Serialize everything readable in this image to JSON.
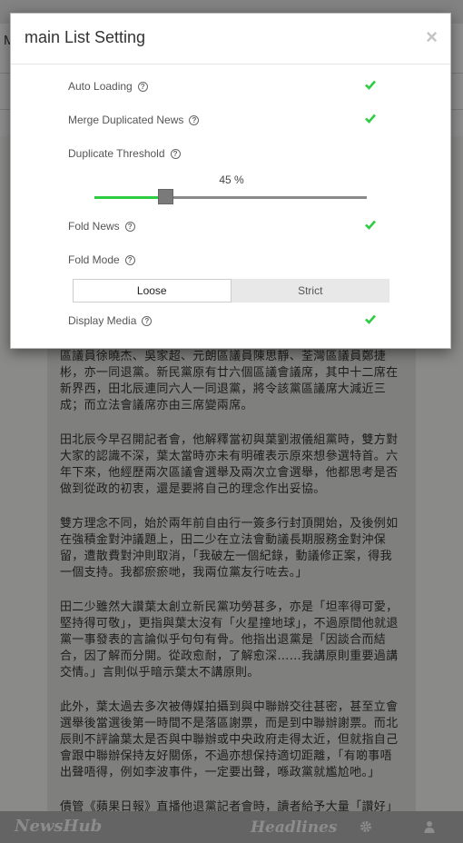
{
  "modal": {
    "title": "main List Setting",
    "close_label": "×"
  },
  "settings": {
    "auto_loading": {
      "label": "Auto Loading",
      "enabled": true
    },
    "merge_duplicated_news": {
      "label": "Merge Duplicated News",
      "enabled": true
    },
    "duplicate_threshold": {
      "label": "Duplicate Threshold",
      "value_text": "45 %",
      "value": 0.45
    },
    "fold_news": {
      "label": "Fold News",
      "enabled": true
    },
    "fold_mode": {
      "label": "Fold Mode",
      "options": [
        "Loose",
        "Strict"
      ],
      "selected": "Loose"
    },
    "display_media": {
      "label": "Display Media",
      "enabled": true
    }
  },
  "help_glyph": "?",
  "background_app": {
    "header_letter": "M",
    "article_paragraphs": [
      "區議員徐曉杰、吳家超、元朗區議員陳思靜、荃灣區議員鄭捷彬，亦一同退黨。新民黨原有廿六個區議會議席，其中十二席在新界西，田北辰連同六人一同退黨，將令該黨區議席大減近三成；而立法會議席亦由三席變兩席。",
      "田北辰今早召開記者會，他解釋當初與葉劉淑儀組黨時，雙方對大家的認識不深，葉太當時亦未有明確表示原來想參選特首。六年下來，他經歷兩次區議會選舉及兩次立會選舉，他都思考是否做到從政的初衷，還是要將自己的理念作出妥協。",
      "雙方理念不同，始於兩年前自由行一簽多行封頂開始，及後例如在強積金對沖議題上，田二少在立法會動議長期服務金對沖保留，遭散費對沖則取消，「我破左一個紀錄，動議修正案，得我一個支持。我都瘀瘀哋，我兩位黨友行咗去。」",
      "田二少雖然大讚葉太創立新民黨功勞甚多，亦是「坦率得可愛，堅持得可敬」，更指與葉太沒有「火星撞地球」，不過原間他就退黨一事發表的言論似乎句句有骨。他指出退黨是「因談合而結合，因了解而分開。從政愈耐，了解愈深……我講原則重要過講交情。」言則似乎暗示葉太不講原則。",
      "此外，葉太過去多次被傳媒拍攝到與中聯辦交往甚密，甚至立會選舉後當選後第一時間不是落區謝票，而是到中聯辦謝票。而北辰則不評論葉太是否與中聯辦或中央政府走得太近，但就指自己會跟中聯辦保持友好關係，不過亦想保持適切距離，「有啲事唔出聲唔得，例如李波事件，一定要出聲，喺政黨就尷尬吔。」",
      "債管《蘋果日報》直播他退黨記者會時，讀者給予大量「讚好」"
    ],
    "bottom_nav": {
      "brand": "NewsHub",
      "headlines": "Headlines"
    }
  },
  "colors": {
    "check_green": "#2ecc40",
    "slider_fill": "#2ecc40"
  }
}
